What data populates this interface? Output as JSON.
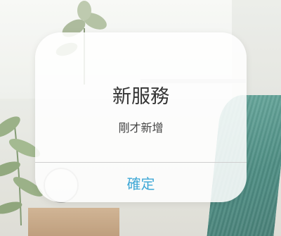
{
  "dialog": {
    "title": "新服務",
    "message": "剛才新增",
    "confirm_label": "確定"
  },
  "colors": {
    "accent": "#3fa8d6",
    "title_text": "#333333",
    "divider": "#cfcfcf"
  }
}
